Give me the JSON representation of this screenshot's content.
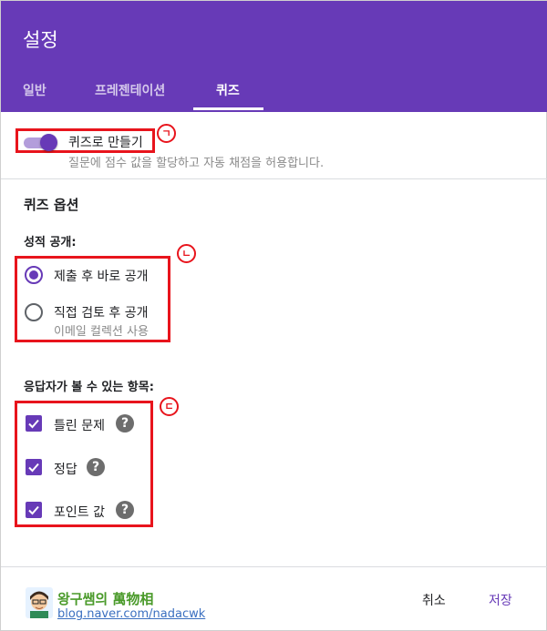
{
  "dialog": {
    "title": "설정"
  },
  "tabs": [
    {
      "label": "일반"
    },
    {
      "label": "프레젠테이션"
    },
    {
      "label": "퀴즈"
    }
  ],
  "quiz_toggle": {
    "label": "퀴즈로 만들기",
    "description": "질문에 점수 값을 할당하고 자동 채점을 허용합니다.",
    "on": true
  },
  "quiz_options": {
    "heading": "퀴즈 옵션",
    "release_grade": {
      "label": "성적 공개:",
      "options": [
        {
          "label": "제출 후 바로 공개",
          "checked": true
        },
        {
          "label": "직접 검토 후 공개",
          "sublabel": "이메일 컬렉션 사용",
          "checked": false
        }
      ]
    },
    "respondent_can_see": {
      "label": "응답자가 볼 수 있는 항목:",
      "items": [
        {
          "label": "틀린 문제",
          "checked": true,
          "help": "?"
        },
        {
          "label": "정답",
          "checked": true,
          "help": "?"
        },
        {
          "label": "포인트 값",
          "checked": true,
          "help": "?"
        }
      ]
    }
  },
  "annotations": {
    "a": "ㄱ",
    "b": "ㄴ",
    "c": "ㄷ"
  },
  "footer": {
    "cancel": "취소",
    "save": "저장",
    "watermark_title": "왕구쌤의 萬物相",
    "watermark_url": "blog.naver.com/nadacwk"
  },
  "colors": {
    "accent": "#673ab7",
    "annotation": "#e8141c"
  }
}
